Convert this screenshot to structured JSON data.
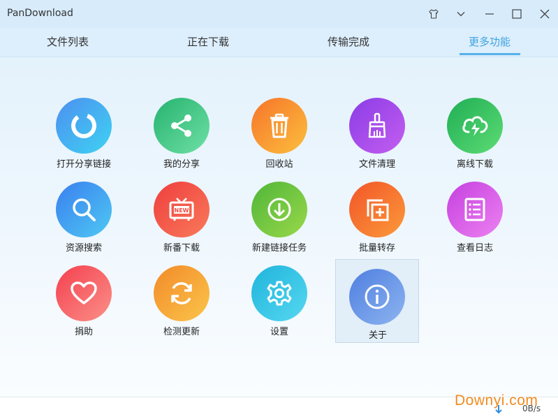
{
  "window": {
    "title": "PanDownload"
  },
  "tabs": [
    {
      "label": "文件列表"
    },
    {
      "label": "正在下载"
    },
    {
      "label": "传输完成"
    },
    {
      "label": "更多功能",
      "active": true
    }
  ],
  "features": [
    {
      "label": "打开分享链接",
      "icon": "pie-ring-icon",
      "color": "#3aa9f0"
    },
    {
      "label": "我的分享",
      "icon": "share-icon",
      "color": "#2fc58a"
    },
    {
      "label": "回收站",
      "icon": "trash-icon",
      "color": "#f7922a"
    },
    {
      "label": "文件清理",
      "icon": "brush-icon",
      "color": "#9b46e8"
    },
    {
      "label": "离线下载",
      "icon": "cloud-download-icon",
      "color": "#2ec466"
    },
    {
      "label": "资源搜索",
      "icon": "search-icon",
      "color": "#3b8ff0"
    },
    {
      "label": "新番下载",
      "icon": "tv-new-icon",
      "color": "#f2534b"
    },
    {
      "label": "新建链接任务",
      "icon": "download-circle-icon",
      "color": "#6cc63c"
    },
    {
      "label": "批量转存",
      "icon": "batch-add-icon",
      "color": "#f26a2a"
    },
    {
      "label": "查看日志",
      "icon": "log-list-icon",
      "color": "#d556e6"
    },
    {
      "label": "捐助",
      "icon": "heart-icon",
      "color": "#f75a63"
    },
    {
      "label": "检测更新",
      "icon": "refresh-icon",
      "color": "#f5a033"
    },
    {
      "label": "设置",
      "icon": "gear-icon",
      "color": "#2cbde3"
    },
    {
      "label": "关于",
      "icon": "info-icon",
      "color": "#5b8fe8",
      "selected": true
    }
  ],
  "status": {
    "speed": "0B/s"
  },
  "watermark": "Downyi.com"
}
